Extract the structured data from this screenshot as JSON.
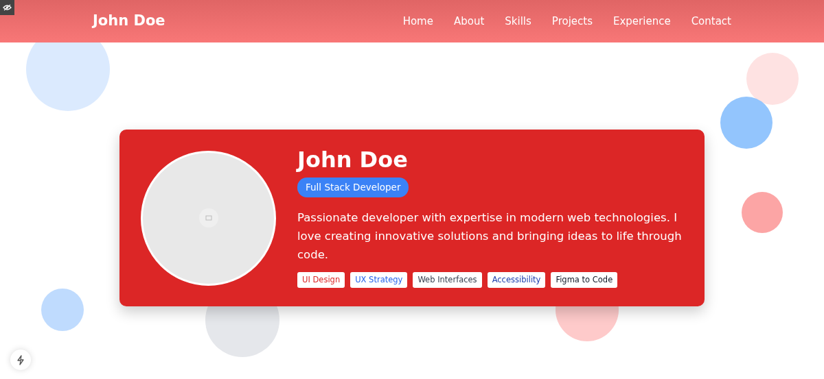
{
  "navbar": {
    "brand": "John Doe",
    "links": [
      {
        "label": "Home"
      },
      {
        "label": "About"
      },
      {
        "label": "Skills"
      },
      {
        "label": "Projects"
      },
      {
        "label": "Experience"
      },
      {
        "label": "Contact"
      }
    ]
  },
  "profile": {
    "name": "John Doe",
    "role": "Full Stack Developer",
    "bio": "Passionate developer with expertise in modern web technologies. I love creating innovative solutions and bringing ideas to life through code.",
    "tags": [
      {
        "label": "UI Design",
        "color": "#dc2626"
      },
      {
        "label": "UX Strategy",
        "color": "#2563eb"
      },
      {
        "label": "Web Interfaces",
        "color": "#374151"
      },
      {
        "label": "Accessibility",
        "color": "#1e40af"
      },
      {
        "label": "Figma to Code",
        "color": "#111827"
      }
    ]
  }
}
